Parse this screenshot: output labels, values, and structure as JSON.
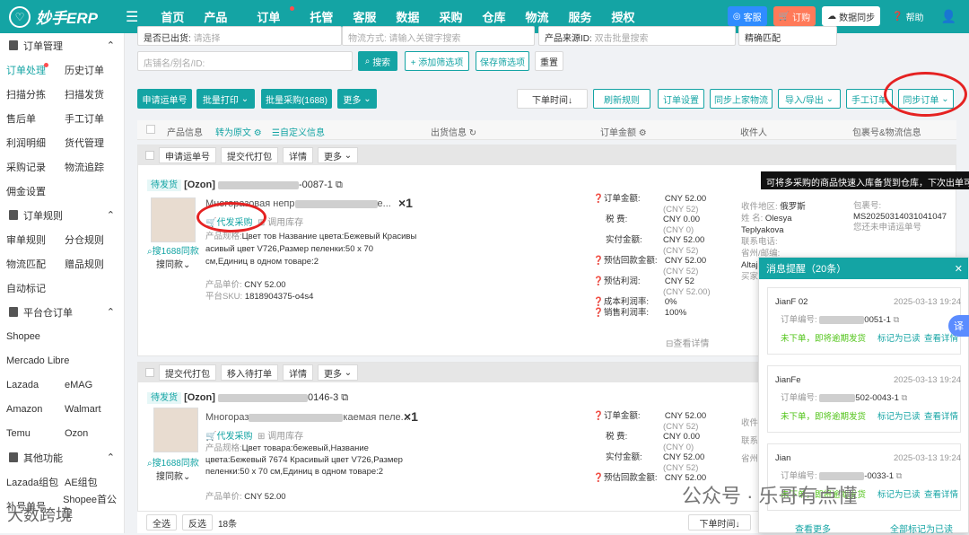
{
  "brand": {
    "name": "妙手ERP"
  },
  "nav": [
    "首页",
    "产品",
    "订单",
    "托管",
    "客服",
    "数据",
    "采购",
    "仓库",
    "物流",
    "服务",
    "授权"
  ],
  "topright": {
    "service": "客服",
    "order": "订购",
    "sync": "数据同步",
    "help": "帮助"
  },
  "sidebar": {
    "s1": "订单管理",
    "r1": [
      "订单处理",
      "历史订单"
    ],
    "r2": [
      "扫描分拣",
      "扫描发货"
    ],
    "r3": [
      "售后单",
      "手工订单"
    ],
    "r4": [
      "利润明细",
      "货代管理"
    ],
    "r5": [
      "采购记录",
      "物流追踪"
    ],
    "r6": [
      "佣金设置"
    ],
    "s2": "订单规则",
    "r7": [
      "审单规则",
      "分仓规则"
    ],
    "r8": [
      "物流匹配",
      "赠品规则"
    ],
    "r9": [
      "自动标记"
    ],
    "s3": "平台仓订单",
    "r10": [
      "Shopee"
    ],
    "r11": [
      "Mercado Libre"
    ],
    "r12": [
      "Lazada",
      "eMAG"
    ],
    "r13": [
      "Amazon",
      "Walmart"
    ],
    "r14": [
      "Temu",
      "Ozon"
    ],
    "s4": "其他功能",
    "r15": [
      "Lazada组包",
      "AE组包"
    ],
    "r16": [
      "补号单号",
      "Shopee首公里"
    ]
  },
  "filters": {
    "status": "是否已出货:",
    "status_ph": "请选择",
    "logistics_ph": "物流方式: 请输入关键字搜索",
    "source": "产品来源ID:",
    "source_ph": "双击批量搜索",
    "match": "精确匹配",
    "shop_ph": "店铺名/别名/ID:",
    "search": "搜索",
    "add": "+ 添加筛选项",
    "save": "保存筛选项",
    "reset": "重置"
  },
  "actions": {
    "apply": "申请运单号",
    "print": "批量打印",
    "buy": "批量采购(1688)",
    "more": "更多",
    "time": "下单时间↓",
    "refresh": "刷新规则",
    "settings": "订单设置",
    "syncl": "同步上家物流",
    "io": "导入/导出",
    "manual": "手工订单",
    "sync": "同步订单"
  },
  "thead": {
    "product": "产品信息",
    "orig": "转为原文",
    "custom": "自定义信息",
    "ship": "出货信息",
    "amount": "订单金额",
    "recv": "收件人",
    "pkg": "包裹号&物流信息"
  },
  "order1": {
    "bar": [
      "申请运单号",
      "提交代打包",
      "详情",
      "更多"
    ],
    "status": "待发货",
    "platform": "[Ozon]",
    "id_tail": "-0087-1",
    "title": "Многоразовая непр",
    "title2": "е...",
    "qty": "×1",
    "purchase": "代发采购",
    "stock": "调用库存",
    "search1688": "搜1688同款",
    "similar": "搜同款",
    "spec_label": "产品规格:",
    "spec": "Цвет тов          Название цвета:Бежевый Красивы         асивый цвет V726,Размер пеленки:50 x 70 см,Единиц в одном товаре:2",
    "price_label": "产品单价:",
    "price": "CNY 52.00",
    "sku_label": "平台SKU:",
    "sku": "1818904375-o4s4",
    "amt": [
      [
        "订单金额:",
        "CNY 52.00",
        "(CNY 52)"
      ],
      [
        "税  费:",
        "CNY 0.00",
        "(CNY 0)"
      ],
      [
        "实付金额:",
        "CNY 52.00",
        "(CNY 52)"
      ],
      [
        "预估回款金额:",
        "CNY 52.00",
        "(CNY 52)"
      ],
      [
        "预估利润:",
        "CNY 52",
        "(CNY 52.00)"
      ],
      [
        "成本利润率:",
        "0%",
        ""
      ],
      [
        "销售利润率:",
        "100%",
        ""
      ]
    ],
    "detail": "查看详情",
    "recv": [
      [
        "收件地区:",
        "俄罗斯"
      ],
      [
        "姓  名:",
        "Olesya Teplyakova"
      ],
      [
        "联系电话:",
        ""
      ],
      [
        "省州/邮编:",
        "Altajskij /"
      ],
      [
        "买家",
        ""
      ]
    ],
    "pkg_label": "包裹号:",
    "pkg": "MS20250314031041047",
    "pkg_note": "您还未申请运单号"
  },
  "order2": {
    "bar": [
      "提交代打包",
      "移入待打单",
      "详情",
      "更多"
    ],
    "status": "待发货",
    "platform": "[Ozon]",
    "id_tail": "0146-3",
    "title": "Многораз",
    "title2": "каемая пеле...",
    "qty": "×1",
    "purchase": "代发采购",
    "stock": "调用库存",
    "search1688": "搜1688同款",
    "similar": "搜同款",
    "spec_label": "产品规格:",
    "spec": "Цвет товара:бежевый,Название цвета:Бежевый 7674 Красивый цвет V726,Размер пеленки:50 x 70 см,Единиц в одном товаре:2",
    "price_label": "产品单价:",
    "price": "CNY 52.00",
    "amt": [
      [
        "订单金额:",
        "CNY 52.00",
        "(CNY 52)"
      ],
      [
        "税  费:",
        "CNY 0.00",
        "(CNY 0)"
      ],
      [
        "实付金额:",
        "CNY 52.00",
        "(CNY 52)"
      ],
      [
        "预估回款金额:",
        "CNY 52.00",
        ""
      ]
    ],
    "recv": [
      "收件",
      "联系",
      "省州"
    ]
  },
  "bottom": {
    "all": "全选",
    "inv": "反选",
    "count": "18条",
    "time": "下单时间↓"
  },
  "tooltip": "可将多采购的商品快速入库备货到仓库，下次出单可",
  "panel": {
    "title": "消息提醒（20条）",
    "msgs": [
      {
        "name": "JianF        02",
        "time": "2025-03-13 19:24",
        "order": "订单编号:",
        "tail": "0051-1",
        "status": "未下单，即将逾期发货",
        "mark": "标记为已读",
        "view": "查看详情"
      },
      {
        "name": "JianFe     ",
        "time": "2025-03-13 19:24",
        "order": "订单编号:",
        "tail": "502-0043-1",
        "status": "未下单，即将逾期发货",
        "mark": "标记为已读",
        "view": "查看详情"
      },
      {
        "name": "Jian       ",
        "time": "2025-03-13 19:24",
        "order": "订单编号:",
        "tail": "-0033-1",
        "status": "未下单，即将逾期发货",
        "mark": "标记为已读",
        "view": "查看详情"
      }
    ],
    "more": "查看更多",
    "readall": "全部标记为已读"
  },
  "watermark": {
    "left": "大数跨境",
    "right": "公众号 · 乐哥有点懂"
  },
  "float": "译"
}
